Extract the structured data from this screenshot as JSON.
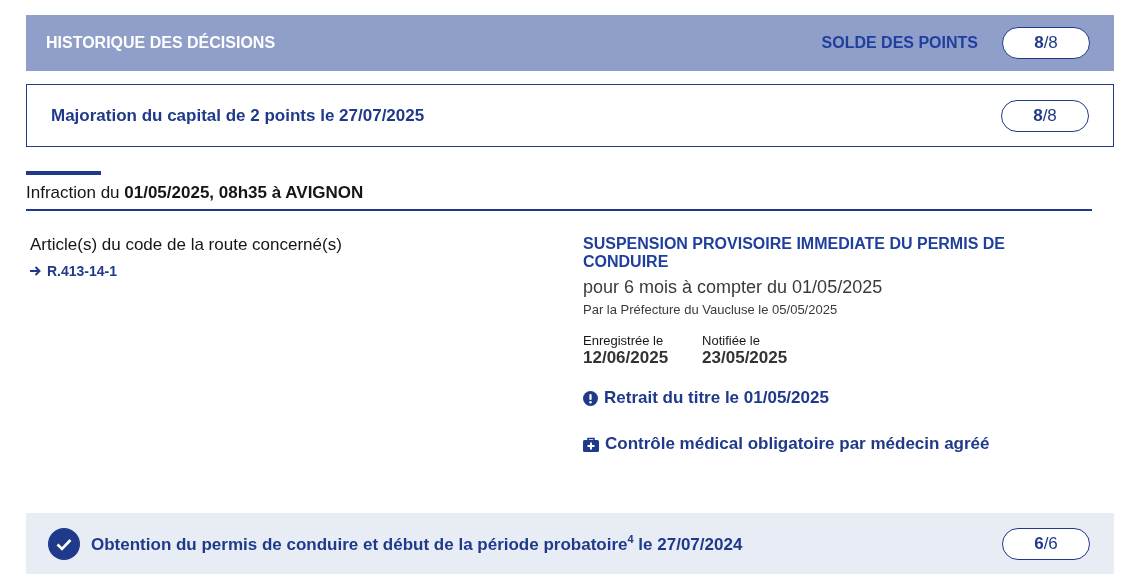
{
  "header": {
    "title": "HISTORIQUE DES DÉCISIONS",
    "balance_label": "SOLDE DES POINTS",
    "balance": "**8**/8"
  },
  "events": [
    {
      "kind": "outlined",
      "text": "Majoration du capital de 2 points le 27/07/2025",
      "score": "**8**/8"
    }
  ],
  "infraction": {
    "title": "Infraction du **01/05/2025, 08h35 à AVIGNON**",
    "articles_label": "Article(s) du code de la route concerné(s)",
    "articles": [
      "R.413-14-1"
    ],
    "decision": {
      "title": "SUSPENSION PROVISOIRE IMMEDIATE DU PERMIS DE CONDUIRE",
      "duration": "pour 6 mois à compter du 01/05/2025",
      "authority": "Par la Préfecture du Vaucluse le 05/05/2025",
      "dates": [
        {
          "label": "Enregistrée le",
          "value": "12/06/2025"
        },
        {
          "label": "Notifiée le",
          "value": "23/05/2025"
        }
      ],
      "notes": [
        {
          "kind": "warning",
          "text": "Retrait du titre le 01/05/2025"
        },
        {
          "kind": "medical",
          "text": "Contrôle médical obligatoire par médecin agréé"
        }
      ]
    }
  },
  "footer_event": {
    "kind": "done",
    "text": "Obtention du permis de conduire et début de la période probatoire$^{4}$ le 27/07/2024",
    "score": "**6**/6"
  }
}
